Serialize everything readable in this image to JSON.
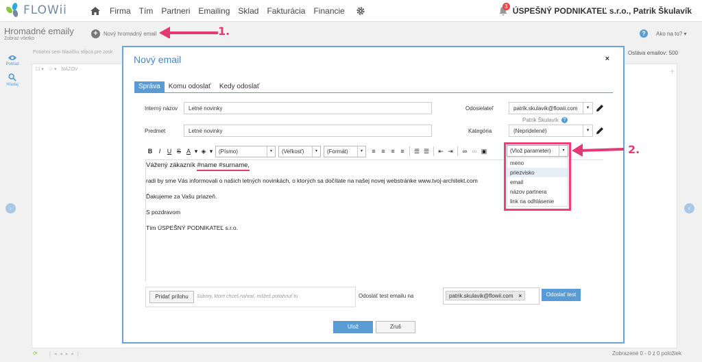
{
  "app": {
    "logo": "FLOWii"
  },
  "nav": {
    "items": [
      "Firma",
      "Tím",
      "Partneri",
      "Emailing",
      "Sklad",
      "Fakturácia",
      "Financie"
    ],
    "notifications_count": "3",
    "company_user": "ÚSPEŠNÝ PODNIKATEĽ s.r.o., Patrik Škulavík"
  },
  "page": {
    "title": "Hromadné emaily",
    "subtitle": "Zobraz všetko",
    "new_email_label": "Nový hromadný email",
    "help_label": "Ako na to?",
    "hint": "Potiahni sem hlavičku stĺpca pre zosk",
    "column_header": "NÁZOV",
    "remaining": "Ostáva emailov: 500",
    "footer_status": "Zobrazené 0 - 0 z 0 položiek"
  },
  "sidebar": {
    "view_label": "Pohľad",
    "search_label": "Hľadaj"
  },
  "modal": {
    "title": "Nový email",
    "close": "×",
    "tabs": [
      "Správa",
      "Komu odoslať",
      "Kedy odoslať"
    ],
    "active_tab": "Správa",
    "internal_name_label": "Interný názov",
    "internal_name_value": "Letné novinky",
    "subject_label": "Predmet",
    "subject_value": "Letné novinky",
    "sender_label": "Odosielateľ",
    "sender_value": "patrik.skulavik@flowii.com",
    "sender_name": "Patrik Škulavík",
    "category_label": "Kategória",
    "category_value": "(Nepridelené)",
    "toolbar": {
      "bold": "B",
      "italic": "I",
      "underline": "U",
      "strike": "S",
      "font_select": "(Písmo)",
      "size_select": "(Veľkosť)",
      "format_select": "(Formát)"
    },
    "param_select": "(Vlož parameter)",
    "param_options": [
      "meno",
      "priezvisko",
      "email",
      "názov partnera",
      "link na odhlásenie"
    ],
    "param_highlighted": "priezvisko",
    "body": {
      "greeting_prefix": "Vážený zákazník",
      "greeting_params": "#name #surname,",
      "line2": "radi by sme Vás informovali o našich letných novinkách, o ktorých sa dočítate na našej novej webstránke www.tvoj-architekt.com",
      "line3": "Ďakujeme za Vašu priazeň.",
      "line4": "S pozdravom",
      "line5": "Tím ÚSPEŠNÝ PODNIKATEĽ s.r.o."
    },
    "attach_button": "Pridať prílohu",
    "attach_hint": "Súbory, ktoré chceš nahrať, môžeš potiahnuť tu",
    "test_label": "Odoslať test emailu na",
    "test_email": "patrik.skulavik@flowii.com",
    "chip_remove": "×",
    "send_test_button": "Odoslať test",
    "save_button": "Ulož",
    "cancel_button": "Zruš"
  },
  "annotations": {
    "first": "1.",
    "second": "2."
  },
  "colors": {
    "accent": "#5b9bd5",
    "annotation": "#e53975",
    "modal_border": "#6aa3d9"
  }
}
